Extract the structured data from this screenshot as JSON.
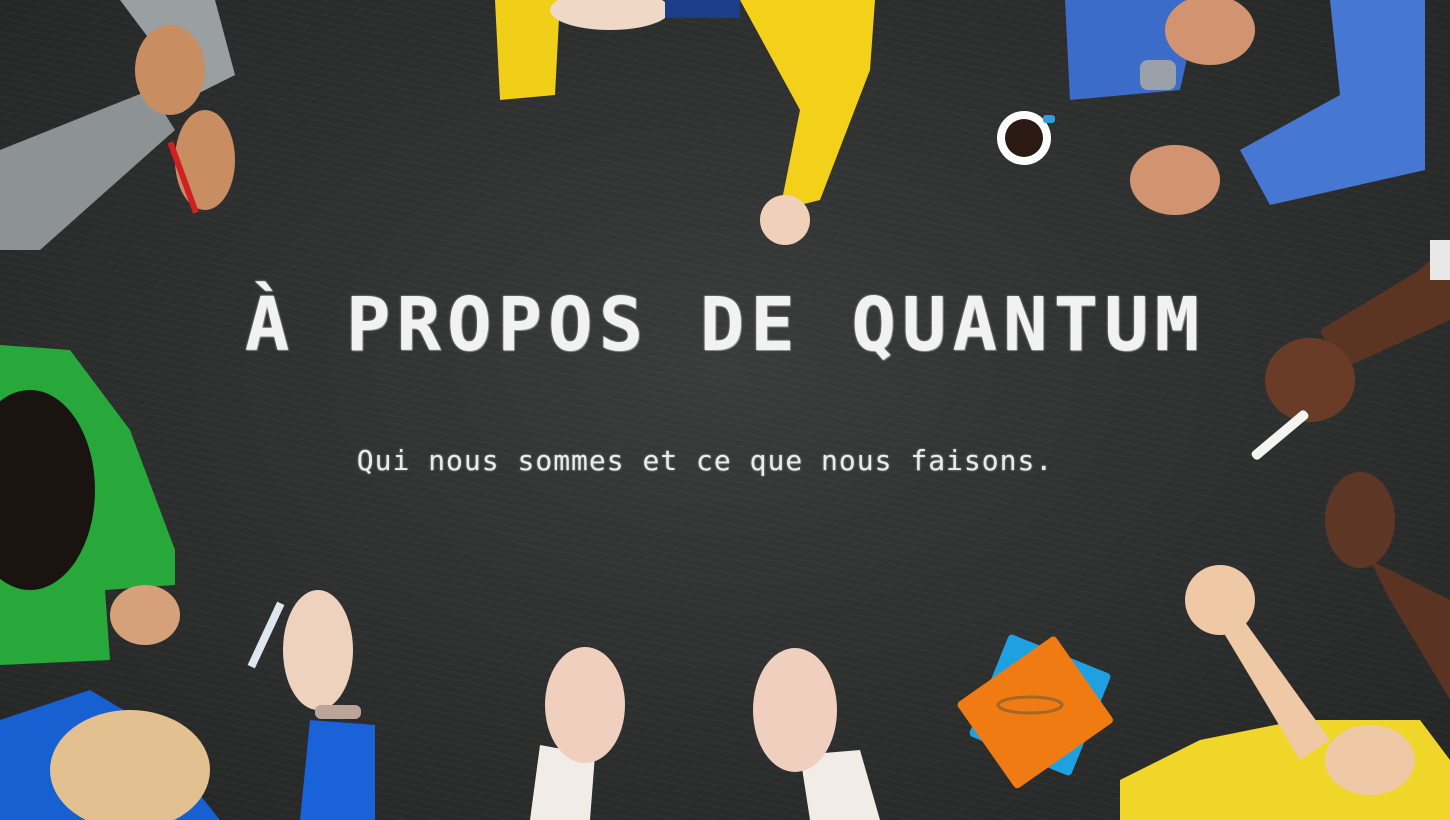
{
  "hero": {
    "title": "À PROPOS DE QUANTUM",
    "subtitle": "Qui nous sommes et ce que nous faisons."
  },
  "colors": {
    "board": "#2f3030",
    "chalk": "#f2f2f2"
  }
}
